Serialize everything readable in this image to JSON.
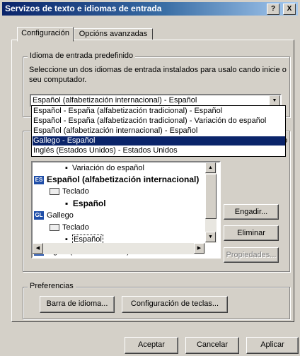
{
  "window": {
    "title": "Servizos de texto e idiomas de entrada",
    "help_btn": "?",
    "close_btn": "X"
  },
  "tabs": [
    {
      "label": "Configuración",
      "active": true
    },
    {
      "label": "Opcións avanzadas",
      "active": false
    }
  ],
  "default_input": {
    "legend": "Idioma de entrada predefinido",
    "description": "Seleccione un dos idiomas de entrada instalados para usalo cando inicie o seu computador.",
    "selected": "Español (alfabetización internacional) - Español",
    "dropdown_arrow": "▼",
    "options": [
      "Español - España (alfabetización tradicional) - Español",
      "Español - España (alfabetización tradicional) - Variación do español",
      "Español (alfabetización internacional) - Español",
      "Gallego - Español",
      "Inglés (Estados Unidos) - Estados Unidos"
    ],
    "highlighted_index": 3
  },
  "installed": {
    "legend_fragment": "o",
    "tree": [
      {
        "text": "Variación do español",
        "kind": "bullet",
        "bold": false
      },
      {
        "text": "Español (alfabetización internacional)",
        "kind": "lang",
        "flag": "ES",
        "bold": true
      },
      {
        "text": "Teclado",
        "kind": "keyboard",
        "bold": false
      },
      {
        "text": "Español",
        "kind": "bullet",
        "bold": true
      },
      {
        "text": "Gallego",
        "kind": "lang",
        "flag": "GL",
        "bold": false
      },
      {
        "text": "Teclado",
        "kind": "keyboard",
        "bold": false
      },
      {
        "text": "Español",
        "kind": "bullet",
        "bold": false
      },
      {
        "text": "Inglés (Estados Unidos)",
        "kind": "lang",
        "flag": "EN",
        "bold": false
      }
    ],
    "add_btn": "Engadir...",
    "remove_btn": "Eliminar",
    "props_btn": "Propiedades..."
  },
  "preferences": {
    "legend": "Preferencias",
    "langbar_btn": "Barra de idioma...",
    "keys_btn": "Configuración de teclas..."
  },
  "footer": {
    "ok_btn": "Aceptar",
    "cancel_btn": "Cancelar",
    "apply_btn": "Aplicar"
  },
  "colors": {
    "titlebar": "#0a246a",
    "face": "#d4d0c8",
    "selection": "#0a246a"
  },
  "icons": [
    "help-icon",
    "close-icon",
    "dropdown-arrow-icon",
    "keyboard-icon",
    "flag-es-icon",
    "flag-gl-icon",
    "scroll-up-icon",
    "scroll-down-icon",
    "scroll-left-icon",
    "scroll-right-icon"
  ]
}
